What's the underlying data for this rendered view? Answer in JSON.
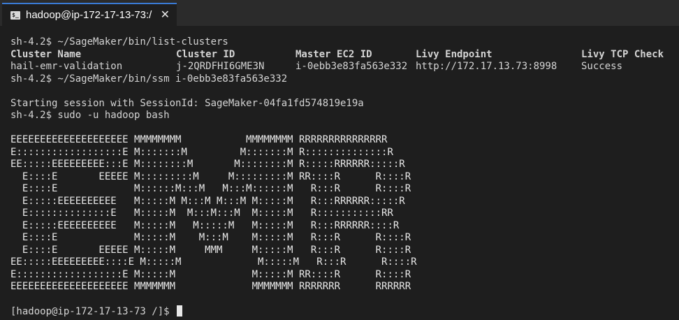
{
  "tab": {
    "icon": "terminal-icon",
    "icon_glyph": "$_",
    "title": "hadoop@ip-172-17-13-73:/",
    "close_glyph": "✕"
  },
  "terminal": {
    "cmd1": "sh-4.2$ ~/SageMaker/bin/list-clusters",
    "table": {
      "headers": [
        "Cluster Name",
        "Cluster ID",
        "Master EC2 ID",
        "Livy Endpoint",
        "Livy TCP Check"
      ],
      "row": [
        "hail-emr-validation",
        "j-2QRDFHI6GME3N",
        "i-0ebb3e83fa563e332",
        "http://172.17.13.73:8998",
        "Success"
      ]
    },
    "cmd2": "sh-4.2$ ~/SageMaker/bin/ssm i-0ebb3e83fa563e332",
    "session": "Starting session with SessionId: SageMaker-04fa1fd574819e19a",
    "cmd3": "sh-4.2$ sudo -u hadoop bash",
    "banner": [
      "EEEEEEEEEEEEEEEEEEEE MMMMMMMM           MMMMMMMM RRRRRRRRRRRRRRR",
      "E::::::::::::::::::E M:::::::M         M:::::::M R::::::::::::::R",
      "EE:::::EEEEEEEEE:::E M::::::::M       M::::::::M R:::::RRRRRR:::::R",
      "  E::::E       EEEEE M:::::::::M     M:::::::::M RR::::R      R::::R",
      "  E::::E             M::::::M:::M   M:::M::::::M   R:::R      R::::R",
      "  E:::::EEEEEEEEEE   M:::::M M:::M M:::M M:::::M   R:::RRRRRR:::::R",
      "  E::::::::::::::E   M:::::M  M:::M:::M  M:::::M   R:::::::::::RR",
      "  E:::::EEEEEEEEEE   M:::::M   M:::::M   M:::::M   R:::RRRRRR::::R",
      "  E::::E             M:::::M    M:::M    M:::::M   R:::R      R::::R",
      "  E::::E       EEEEE M:::::M     MMM     M:::::M   R:::R      R::::R",
      "EE:::::EEEEEEEEE::::E M:::::M             M:::::M   R:::R      R::::R",
      "E::::::::::::::::::E M:::::M             M:::::M RR::::R      R::::R",
      "EEEEEEEEEEEEEEEEEEEE MMMMMMM             MMMMMMM RRRRRRR      RRRRRR"
    ],
    "prompt": "[hadoop@ip-172-17-13-73 /]$ "
  }
}
